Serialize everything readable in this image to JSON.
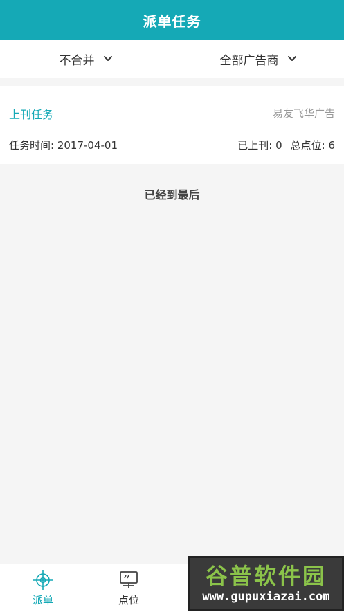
{
  "header": {
    "title": "派单任务"
  },
  "filters": {
    "merge": {
      "label": "不合并",
      "icon": "chevron-down-icon"
    },
    "advertiser": {
      "label": "全部广告商",
      "icon": "chevron-down-icon"
    }
  },
  "task": {
    "type": "上刊任务",
    "advertiser": "易友飞华广告",
    "time": "任务时间: 2017-04-01",
    "posted": "已上刊: 0",
    "total": "总点位: 6"
  },
  "list_end": "已经到最后",
  "tabbar": {
    "tabs": [
      {
        "label": "派单",
        "icon": "crosshair-icon",
        "active": true
      },
      {
        "label": "点位",
        "icon": "billboard-icon",
        "active": false
      }
    ]
  },
  "watermark": {
    "main": "谷普软件园",
    "url": "www.gupuxiazai.com"
  },
  "colors": {
    "accent": "#15a9b6",
    "background": "#f5f5f5"
  }
}
